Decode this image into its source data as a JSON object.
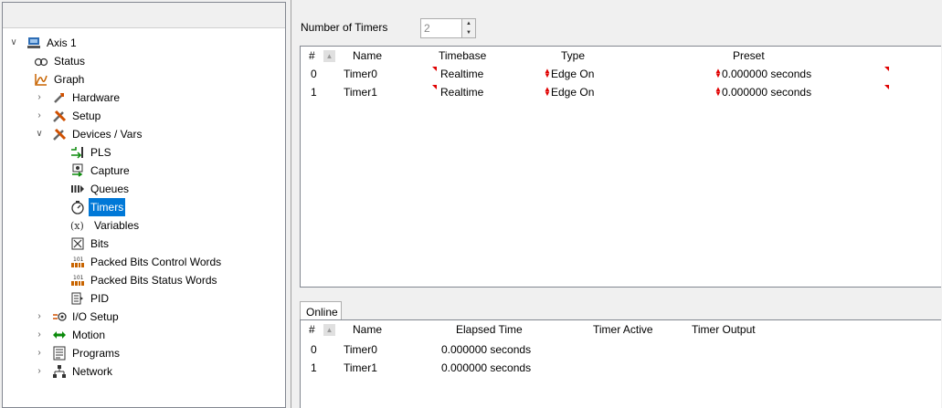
{
  "tree": {
    "items": [
      {
        "label": "Axis 1",
        "icon": "axis-icon",
        "expanded": true
      },
      {
        "label": "Status",
        "icon": "status-icon"
      },
      {
        "label": "Graph",
        "icon": "graph-icon"
      },
      {
        "label": "Hardware",
        "icon": "hardware-icon"
      },
      {
        "label": "Setup",
        "icon": "setup-icon"
      },
      {
        "label": "Devices / Vars",
        "icon": "devices-icon",
        "expanded": true
      },
      {
        "label": "PLS",
        "icon": "pls-icon"
      },
      {
        "label": "Capture",
        "icon": "capture-icon"
      },
      {
        "label": "Queues",
        "icon": "queues-icon"
      },
      {
        "label": "Timers",
        "icon": "timer-icon",
        "selected": true
      },
      {
        "label": "Variables",
        "icon": "variables-icon"
      },
      {
        "label": "Bits",
        "icon": "bits-icon"
      },
      {
        "label": "Packed Bits Control Words",
        "icon": "packed-bits-icon"
      },
      {
        "label": "Packed Bits Status Words",
        "icon": "packed-bits-icon"
      },
      {
        "label": "PID",
        "icon": "pid-icon"
      },
      {
        "label": "I/O Setup",
        "icon": "io-setup-icon"
      },
      {
        "label": "Motion",
        "icon": "motion-icon"
      },
      {
        "label": "Programs",
        "icon": "programs-icon"
      },
      {
        "label": "Network",
        "icon": "network-icon"
      }
    ]
  },
  "timers_config": {
    "number_label": "Number of Timers",
    "number_value": "2",
    "columns": [
      "#",
      "Name",
      "Timebase",
      "Type",
      "Preset"
    ],
    "rows": [
      {
        "index": "0",
        "name": "Timer0",
        "timebase": "Realtime",
        "type": "Edge On",
        "preset": "0.000000 seconds"
      },
      {
        "index": "1",
        "name": "Timer1",
        "timebase": "Realtime",
        "type": "Edge On",
        "preset": "0.000000 seconds"
      }
    ]
  },
  "online": {
    "tab_label": "Online",
    "columns": [
      "#",
      "Name",
      "Elapsed Time",
      "Timer Active",
      "Timer Output"
    ],
    "rows": [
      {
        "index": "0",
        "name": "Timer0",
        "elapsed": "0.000000 seconds",
        "active": "",
        "output": ""
      },
      {
        "index": "1",
        "name": "Timer1",
        "elapsed": "0.000000 seconds",
        "active": "",
        "output": ""
      }
    ]
  },
  "colors": {
    "selection": "#0078d7",
    "modified_marker": "#e00000"
  }
}
